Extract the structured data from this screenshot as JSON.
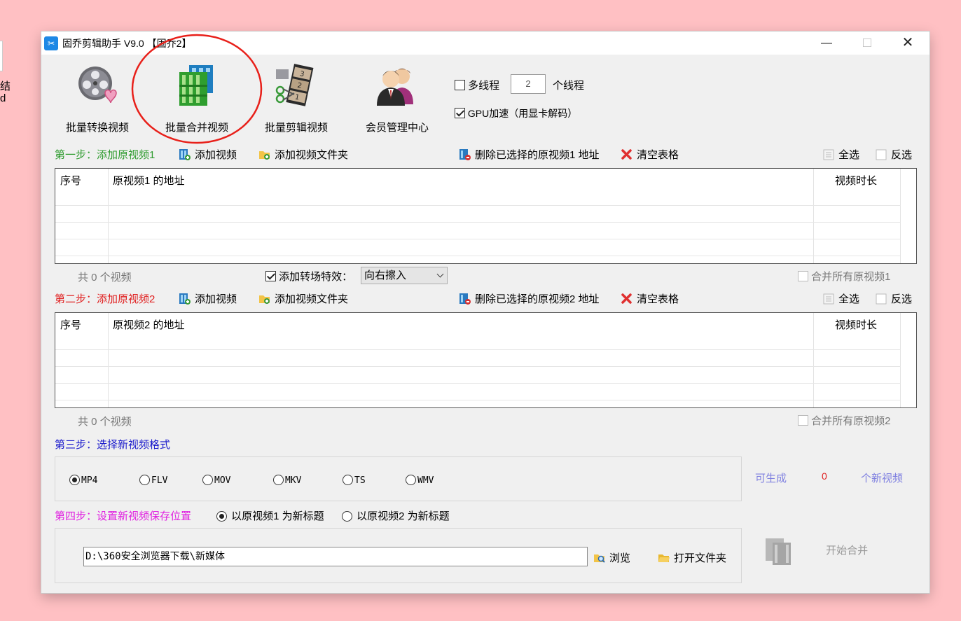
{
  "desktop": {
    "frag1": "结",
    "frag2": "d"
  },
  "window": {
    "title": "固乔剪辑助手 V9.0 【固乔2】",
    "min": "—",
    "max": "□",
    "close": "✕"
  },
  "toolbar": {
    "items": [
      {
        "label": "批量转换视频",
        "icon": "film-reel-heart-icon"
      },
      {
        "label": "批量合并视频",
        "icon": "film-merge-icon"
      },
      {
        "label": "批量剪辑视频",
        "icon": "film-scissors-icon"
      },
      {
        "label": "会员管理中心",
        "icon": "members-icon"
      }
    ],
    "multithread_label": "多线程",
    "multithread_checked": false,
    "thread_count": "2",
    "thread_unit": "个线程",
    "gpu_label": "GPU加速（用显卡解码）",
    "gpu_checked": true
  },
  "step1": {
    "label": "第一步：添加原视频1",
    "color": "#2e9b2e",
    "add_video": "添加视频",
    "add_folder": "添加视频文件夹",
    "delete_selected": "删除已选择的原视频1 地址",
    "clear_table": "清空表格",
    "select_all": "全选",
    "invert": "反选",
    "columns": [
      "序号",
      "原视频1 的地址",
      "视频时长"
    ],
    "count_text": "共 0 个视频",
    "merge_all": "合并所有原视频1"
  },
  "transition": {
    "label": "添加转场特效：",
    "checked": true,
    "selected": "向右擦入"
  },
  "step2": {
    "label": "第二步：添加原视频2",
    "color": "#e02020",
    "add_video": "添加视频",
    "add_folder": "添加视频文件夹",
    "delete_selected": "删除已选择的原视频2 地址",
    "clear_table": "清空表格",
    "select_all": "全选",
    "invert": "反选",
    "columns": [
      "序号",
      "原视频2 的地址",
      "视频时长"
    ],
    "count_text": "共 0 个视频",
    "merge_all": "合并所有原视频2"
  },
  "step3": {
    "label": "第三步：选择新视频格式",
    "color": "#1a1acc",
    "formats": [
      "MP4",
      "FLV",
      "MOV",
      "MKV",
      "TS",
      "WMV"
    ],
    "selected": "MP4",
    "can_generate": "可生成",
    "count": "0",
    "unit": "个新视频"
  },
  "step4": {
    "label": "第四步：设置新视频保存位置",
    "color": "#e020e0",
    "title_opt1": "以原视频1 为新标题",
    "title_opt2": "以原视频2 为新标题",
    "selected_opt": 1,
    "path": "D:\\360安全浏览器下载\\新媒体",
    "browse": "浏览",
    "open_folder": "打开文件夹",
    "start_merge": "开始合并"
  },
  "annotation": {
    "color": "#e8201a"
  }
}
